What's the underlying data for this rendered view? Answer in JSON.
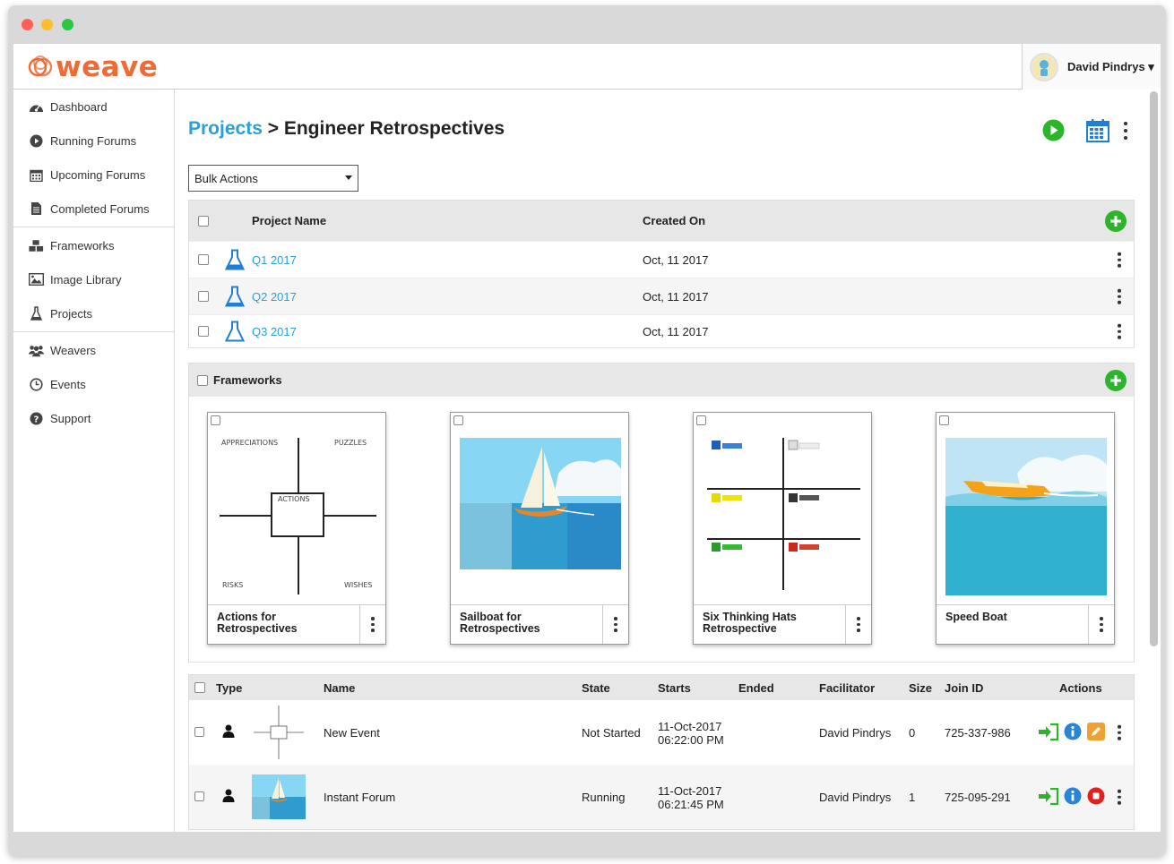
{
  "app": {
    "logo_text": "weave",
    "user_name": "David Pindrys ▾"
  },
  "sidebar": {
    "groups": [
      [
        {
          "label": "Dashboard",
          "icon": "dashboard-icon"
        },
        {
          "label": "Running Forums",
          "icon": "play-icon"
        },
        {
          "label": "Upcoming Forums",
          "icon": "calendar-icon"
        },
        {
          "label": "Completed Forums",
          "icon": "document-icon"
        }
      ],
      [
        {
          "label": "Frameworks",
          "icon": "cubes-icon"
        },
        {
          "label": "Image Library",
          "icon": "image-icon"
        },
        {
          "label": "Projects",
          "icon": "flask-icon"
        }
      ],
      [
        {
          "label": "Weavers",
          "icon": "users-icon"
        },
        {
          "label": "Events",
          "icon": "clock-icon"
        },
        {
          "label": "Support",
          "icon": "question-icon"
        }
      ]
    ]
  },
  "breadcrumb": {
    "root": "Projects",
    "separator": ">",
    "current": "Engineer Retrospectives"
  },
  "bulk_actions": {
    "label": "Bulk Actions"
  },
  "projects_table": {
    "headers": {
      "name": "Project Name",
      "created": "Created On"
    },
    "rows": [
      {
        "name": "Q1 2017",
        "created": "Oct, 11 2017"
      },
      {
        "name": "Q2 2017",
        "created": "Oct, 11 2017"
      },
      {
        "name": "Q3 2017",
        "created": "Oct, 11 2017"
      }
    ]
  },
  "frameworks": {
    "title": "Frameworks",
    "cards": [
      {
        "title": "Actions for Retrospectives",
        "labels": [
          "APPRECIATIONS",
          "PUZZLES",
          "ACTIONS",
          "RISKS",
          "WISHES"
        ]
      },
      {
        "title": "Sailboat for Retrospectives"
      },
      {
        "title": "Six Thinking Hats Retrospective"
      },
      {
        "title": "Speed Boat"
      }
    ]
  },
  "events_table": {
    "headers": {
      "type": "Type",
      "name": "Name",
      "state": "State",
      "starts": "Starts",
      "ended": "Ended",
      "facilitator": "Facilitator",
      "size": "Size",
      "join_id": "Join ID",
      "actions": "Actions"
    },
    "rows": [
      {
        "name": "New Event",
        "state": "Not Started",
        "starts_date": "11-Oct-2017",
        "starts_time": "06:22:00 PM",
        "ended": "",
        "facilitator": "David Pindrys",
        "size": "0",
        "join_id": "725-337-986",
        "third_action": "edit-icon"
      },
      {
        "name": "Instant Forum",
        "state": "Running",
        "starts_date": "11-Oct-2017",
        "starts_time": "06:21:45 PM",
        "ended": "",
        "facilitator": "David Pindrys",
        "size": "1",
        "join_id": "725-095-291",
        "third_action": "stop-icon"
      }
    ]
  },
  "colors": {
    "accent_blue": "#2a9fd8",
    "brand_orange": "#ef6a35",
    "green": "#2cb52c",
    "red": "#e0211d",
    "orange": "#f0a030"
  }
}
